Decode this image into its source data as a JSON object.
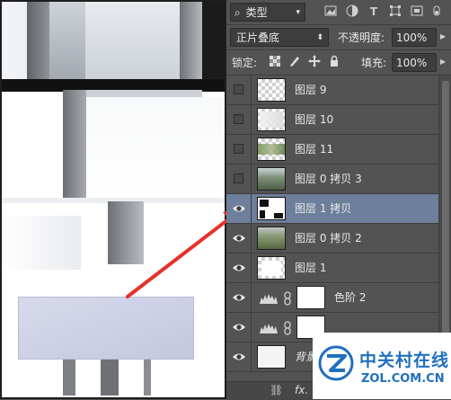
{
  "panel": {
    "filter": {
      "search_icon": "⌕",
      "kind_label": "类型",
      "icons": [
        "image-filter-icon",
        "adjustment-filter-icon",
        "text-filter-icon",
        "shape-filter-icon",
        "smart-object-filter-icon"
      ]
    },
    "blend_mode": "正片叠底",
    "opacity_label": "不透明度:",
    "opacity_value": "100%",
    "lock_label": "锁定:",
    "fill_label": "填充:",
    "fill_value": "100%",
    "layers": [
      {
        "name": "图层 9",
        "visible": false,
        "type": "layer"
      },
      {
        "name": "图层 10",
        "visible": false,
        "type": "layer"
      },
      {
        "name": "图层 11",
        "visible": false,
        "type": "layer"
      },
      {
        "name": "图层 0 拷贝 3",
        "visible": false,
        "type": "layer"
      },
      {
        "name": "图层 1 拷贝",
        "visible": true,
        "type": "layer",
        "selected": true
      },
      {
        "name": "图层 0 拷贝 2",
        "visible": true,
        "type": "layer"
      },
      {
        "name": "图层 1",
        "visible": true,
        "type": "layer"
      },
      {
        "name": "色阶 2",
        "visible": true,
        "type": "adjustment"
      },
      {
        "name": "",
        "visible": true,
        "type": "adjustment"
      },
      {
        "name": "背景",
        "visible": true,
        "type": "layer"
      }
    ],
    "bottom_bar": {
      "link_icon": "⛓",
      "fx_label": "fx."
    }
  },
  "watermark": {
    "brand": "中关村在线",
    "domain": "ZOL.COM.CN"
  },
  "colors": {
    "panel_bg": "#535353",
    "selected_row": "#6d7f9b",
    "annotation_arrow": "#e8302a",
    "watermark_blue": "#1f6fbf"
  }
}
